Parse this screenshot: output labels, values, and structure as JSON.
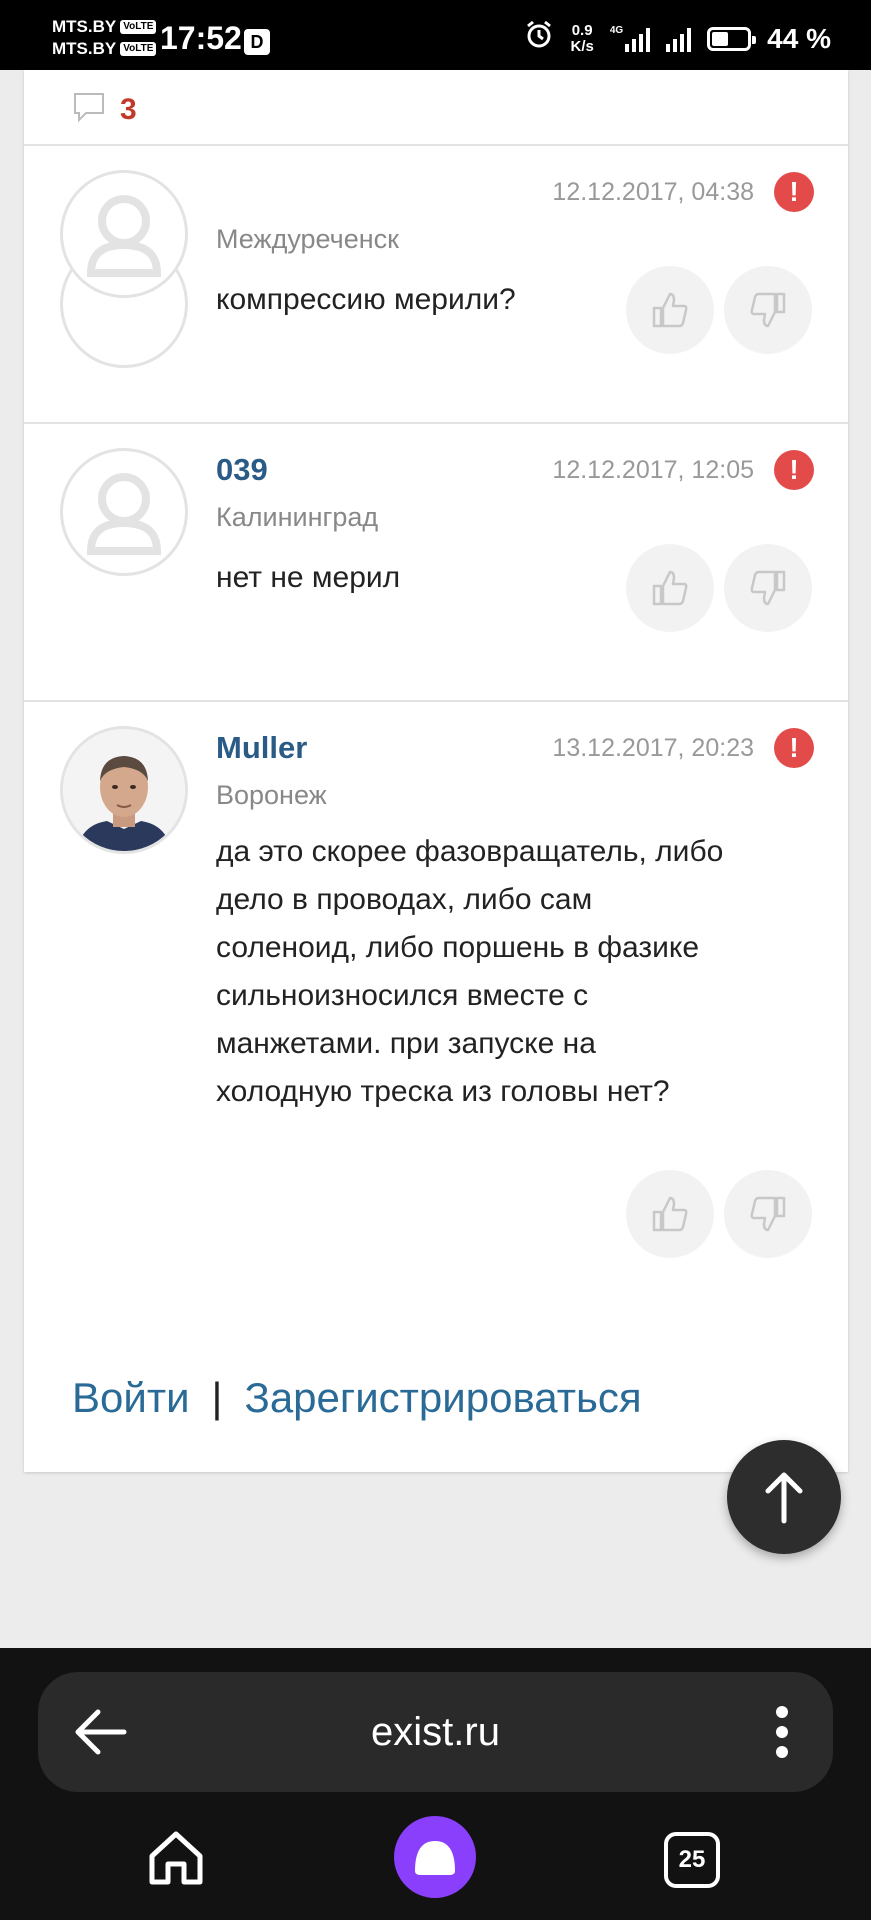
{
  "status_bar": {
    "carrier_1": "MTS.BY",
    "carrier_2": "MTS.BY",
    "volte": "VoLTE",
    "time": "17:52",
    "d_badge": "D",
    "net_speed_value": "0.9",
    "net_speed_unit": "K/s",
    "network_type": "4G",
    "battery": "44 %"
  },
  "comments_header": {
    "count": "3",
    "icon": "comment-icon"
  },
  "comments": [
    {
      "author": "",
      "location": "Междуреченск",
      "date": "12.12.2017, 04:38",
      "text": "компрессию мерили?",
      "avatar": "default-user-avatar"
    },
    {
      "author": "039",
      "location": "Калининград",
      "date": "12.12.2017, 12:05",
      "text": "нет не мерил",
      "avatar": "default-user-avatar"
    },
    {
      "author": "Muller",
      "location": "Воронеж",
      "date": "13.12.2017, 20:23",
      "text_lines": [
        "да это скорее фазовращатель, либо",
        "дело в проводах, либо сам",
        "соленоид, либо поршень в фазике",
        "сильноизносился вместе с",
        "манжетами. при запуске на",
        "холодную треска из головы нет?"
      ],
      "avatar": "user-photo"
    }
  ],
  "report_symbol": "!",
  "auth": {
    "login": "Войти",
    "separator": "|",
    "register": "Зарегистрироваться"
  },
  "browser": {
    "url": "exist.ru",
    "tabs_count": "25"
  },
  "colors": {
    "link": "#2a6a96",
    "author": "#2a5b87",
    "count": "#c0392b",
    "alert": "#e34b4b",
    "alice": "#8a3ffc"
  }
}
